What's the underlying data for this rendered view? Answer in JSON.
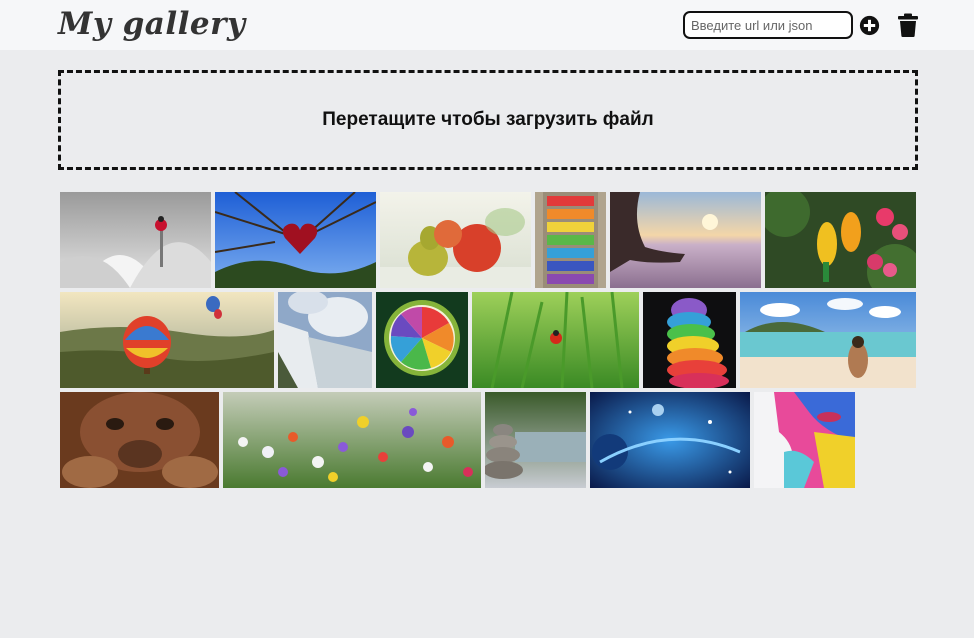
{
  "header": {
    "logo": "My gallery",
    "url_input": {
      "placeholder": "Введите url или json",
      "value": ""
    },
    "add_icon": "plus-circle-icon",
    "delete_icon": "trash-icon"
  },
  "dropzone": {
    "text": "Перетащите чтобы загрузить файл"
  },
  "gallery": {
    "rows": [
      [
        {
          "name": "photo-ladybug-flower",
          "subject": "ladybug on grey flower"
        },
        {
          "name": "photo-heart-branch",
          "subject": "red heart on branches"
        },
        {
          "name": "photo-apples-pears",
          "subject": "apples and pears"
        },
        {
          "name": "photo-rainbow-bows",
          "subject": "rainbow bows"
        },
        {
          "name": "photo-meditation-sunset",
          "subject": "meditation at sunset"
        },
        {
          "name": "photo-parrots",
          "subject": "parrots with flowers"
        }
      ],
      [
        {
          "name": "photo-hot-air-balloons",
          "subject": "hot air balloons"
        },
        {
          "name": "photo-waterfall",
          "subject": "waterfall"
        },
        {
          "name": "photo-rainbow-citrus",
          "subject": "rainbow citrus slice"
        },
        {
          "name": "photo-ladybug-grass",
          "subject": "ladybug in grass"
        },
        {
          "name": "photo-rainbow-ice-cream",
          "subject": "rainbow ice cream"
        },
        {
          "name": "photo-beach",
          "subject": "woman on beach"
        }
      ],
      [
        {
          "name": "photo-orangutan",
          "subject": "orangutan"
        },
        {
          "name": "photo-wildflowers",
          "subject": "wildflowers"
        },
        {
          "name": "photo-stone-stack",
          "subject": "stone stack by water"
        },
        {
          "name": "photo-space",
          "subject": "space planets"
        },
        {
          "name": "photo-colorful-face",
          "subject": "colorful face painting"
        }
      ]
    ]
  },
  "colors": {
    "background": "#ebecee",
    "header_bg": "#f6f7f9",
    "text": "#111111"
  }
}
